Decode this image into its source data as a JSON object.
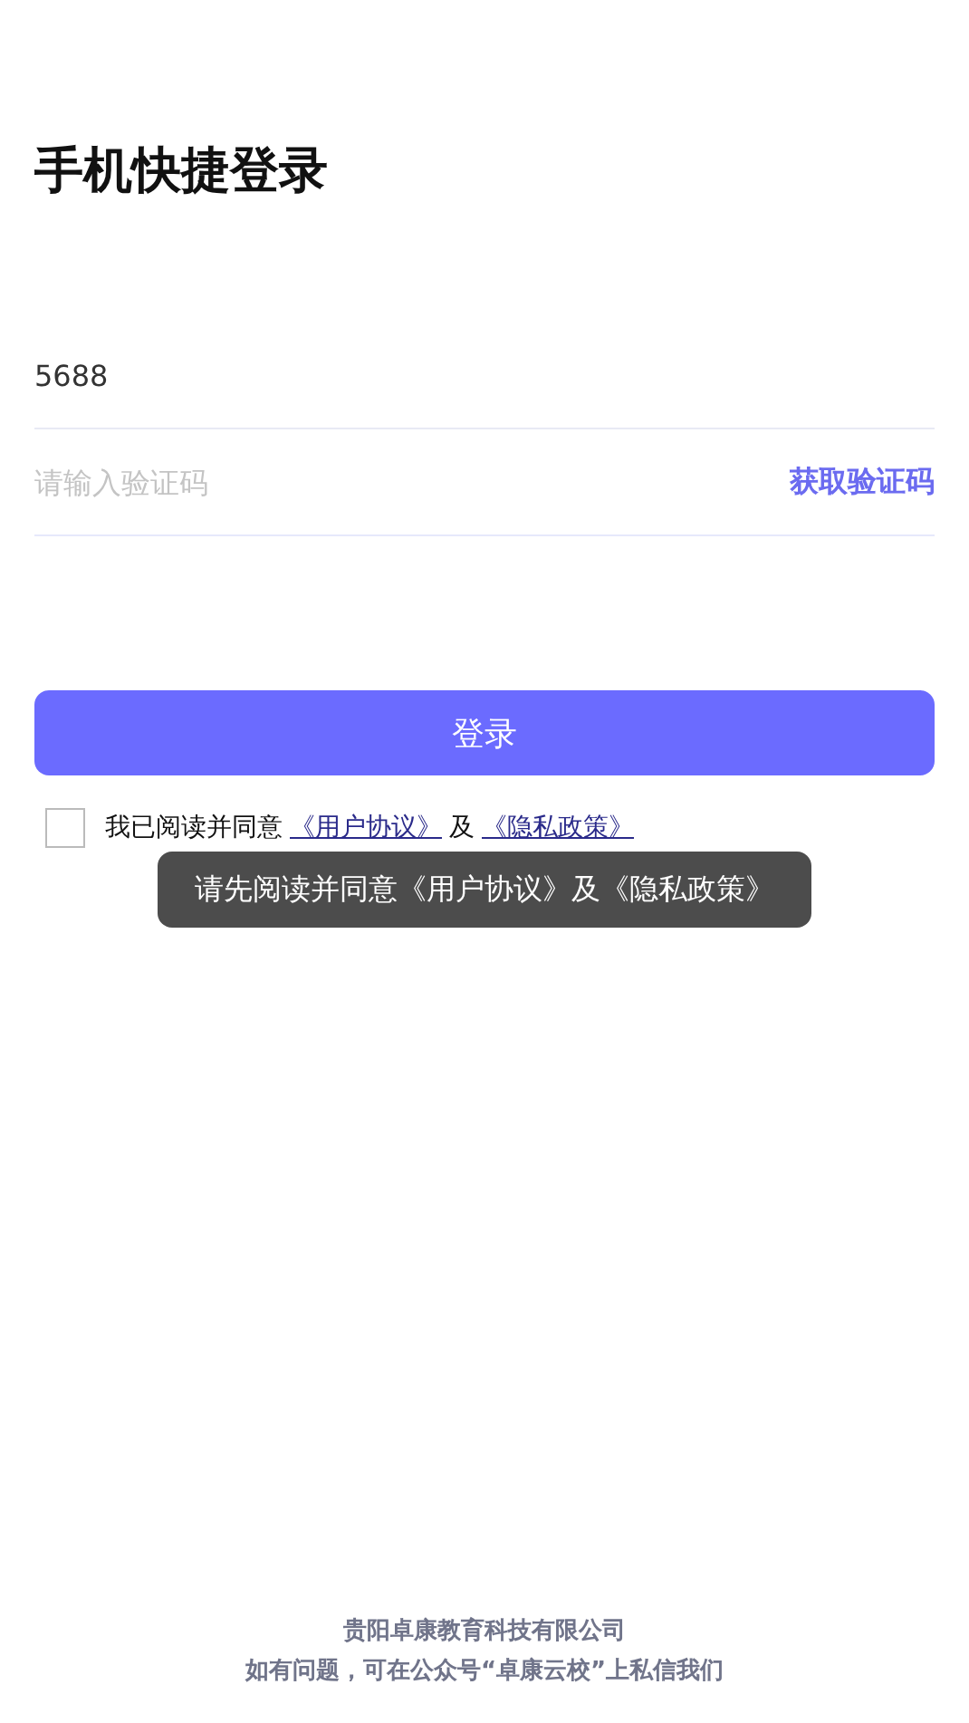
{
  "title": "手机快捷登录",
  "phone_field": {
    "value": "5688"
  },
  "code_field": {
    "placeholder": "请输入验证码"
  },
  "get_code_link": "获取验证码",
  "login_button": "登录",
  "agreement": {
    "checked": false,
    "prefix": "我已阅读并同意",
    "user_agreement": "《用户协议》",
    "conjunction": "及",
    "privacy_policy": "《隐私政策》"
  },
  "toast": "请先阅读并同意《用户协议》及《隐私政策》",
  "footer": [
    "贵阳卓康教育科技有限公司",
    "如有问题，可在公众号“卓康云校”上私信我们"
  ]
}
